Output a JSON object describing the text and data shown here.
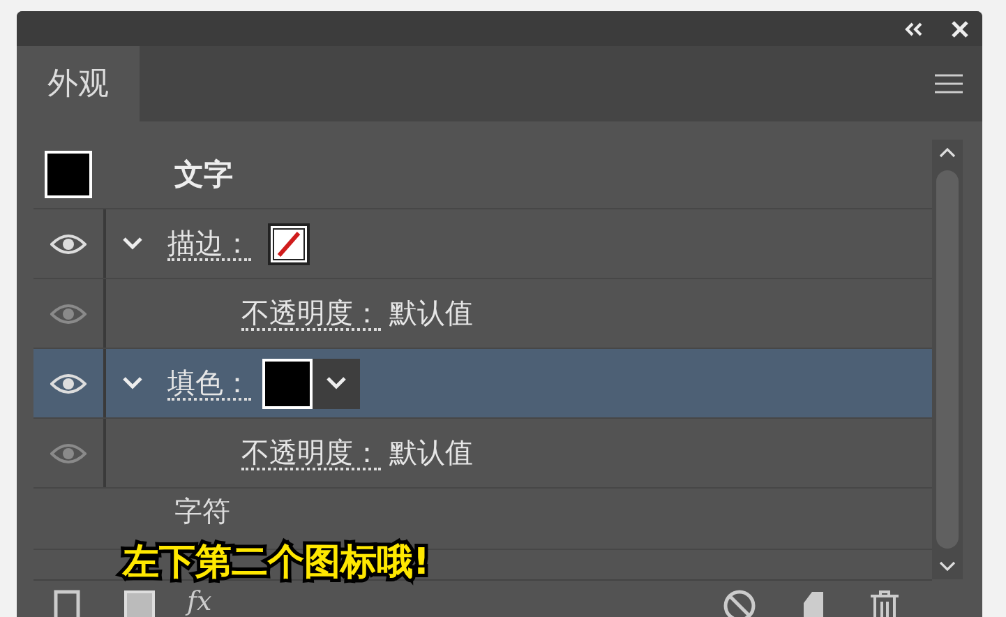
{
  "tab": {
    "label": "外观",
    "selected": true
  },
  "object": {
    "label": "文字"
  },
  "rows": [
    {
      "kind": "attribute",
      "label": "描边：",
      "visible": true,
      "expanded": true,
      "swatch": {
        "kind": "none"
      },
      "selected": false,
      "menu": false
    },
    {
      "kind": "opacity",
      "label": "不透明度：",
      "value": "默认值",
      "visible": false,
      "selected": false
    },
    {
      "kind": "attribute",
      "label": "填色：",
      "visible": true,
      "expanded": true,
      "swatch": {
        "kind": "solid"
      },
      "selected": true,
      "menu": true
    },
    {
      "kind": "opacity",
      "label": "不透明度：",
      "value": "默认值",
      "visible": false,
      "selected": false
    },
    {
      "kind": "group",
      "label": "字符",
      "selected": false
    }
  ],
  "footer": {
    "fx": "fx"
  },
  "caption": "左下第二个图标哦!"
}
